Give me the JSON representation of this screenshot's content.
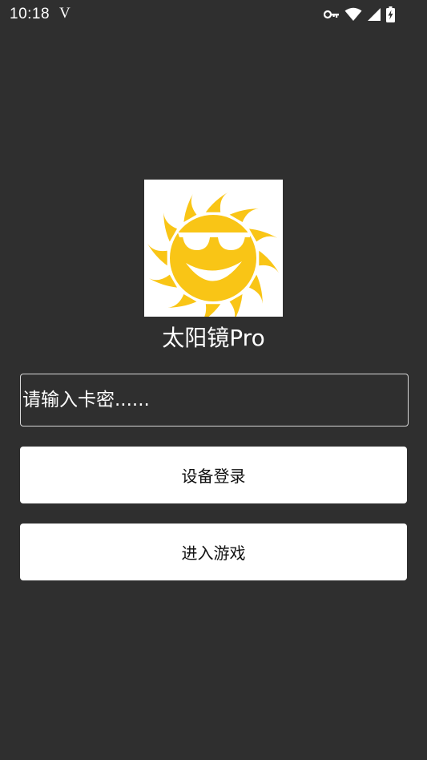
{
  "status_bar": {
    "time": "10:18",
    "carrier_glyph": "V",
    "icons": [
      "vpn-key-icon",
      "wifi-icon",
      "signal-icon",
      "battery-charging-icon"
    ]
  },
  "app": {
    "title": "太阳镜Pro",
    "logo_icon": "sun-with-sunglasses-icon"
  },
  "form": {
    "card_input": {
      "placeholder": "请输入卡密......",
      "value": ""
    },
    "login_button_label": "设备登录",
    "enter_game_button_label": "进入游戏"
  },
  "colors": {
    "background": "#2f2f2f",
    "sun": "#f9c516",
    "button_bg": "#ffffff",
    "button_text": "#111111"
  }
}
